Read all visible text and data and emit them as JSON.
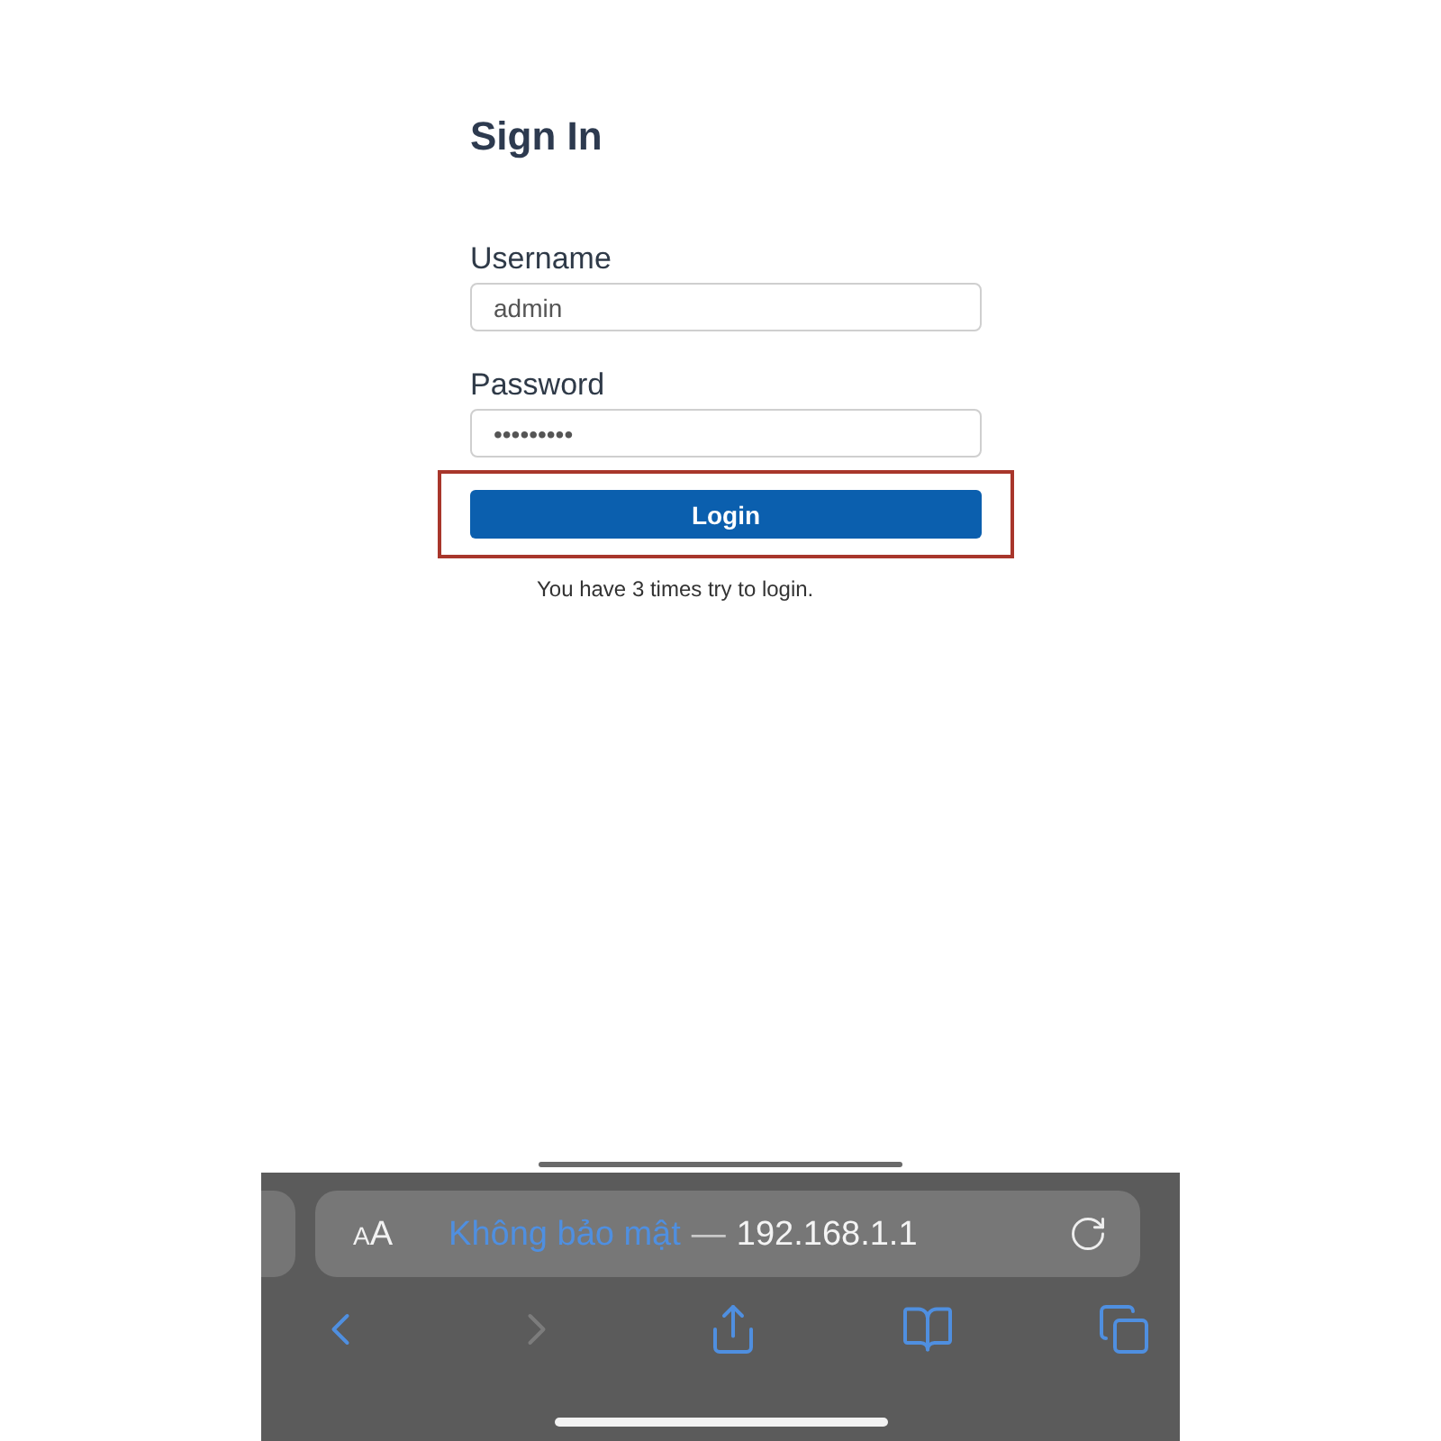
{
  "page": {
    "title": "Sign In",
    "fields": [
      {
        "label": "Username",
        "value": "admin"
      },
      {
        "label": "Password",
        "value": "•••••••••"
      }
    ],
    "login_button": {
      "label": "Login",
      "highlighted": true
    },
    "message": "You have 3 times try to login."
  },
  "browser": {
    "text_size_button": {
      "small_letter": "A",
      "large_letter": "A"
    },
    "address": {
      "security": "Không bảo mật",
      "separator": "—",
      "host": "192.168.1.1"
    },
    "toolbar": [
      {
        "kind": "back",
        "disabled": false
      },
      {
        "kind": "forward",
        "disabled": true
      },
      {
        "kind": "share",
        "disabled": false
      },
      {
        "kind": "bookmarks",
        "disabled": false
      },
      {
        "kind": "tabs",
        "disabled": false
      }
    ]
  }
}
